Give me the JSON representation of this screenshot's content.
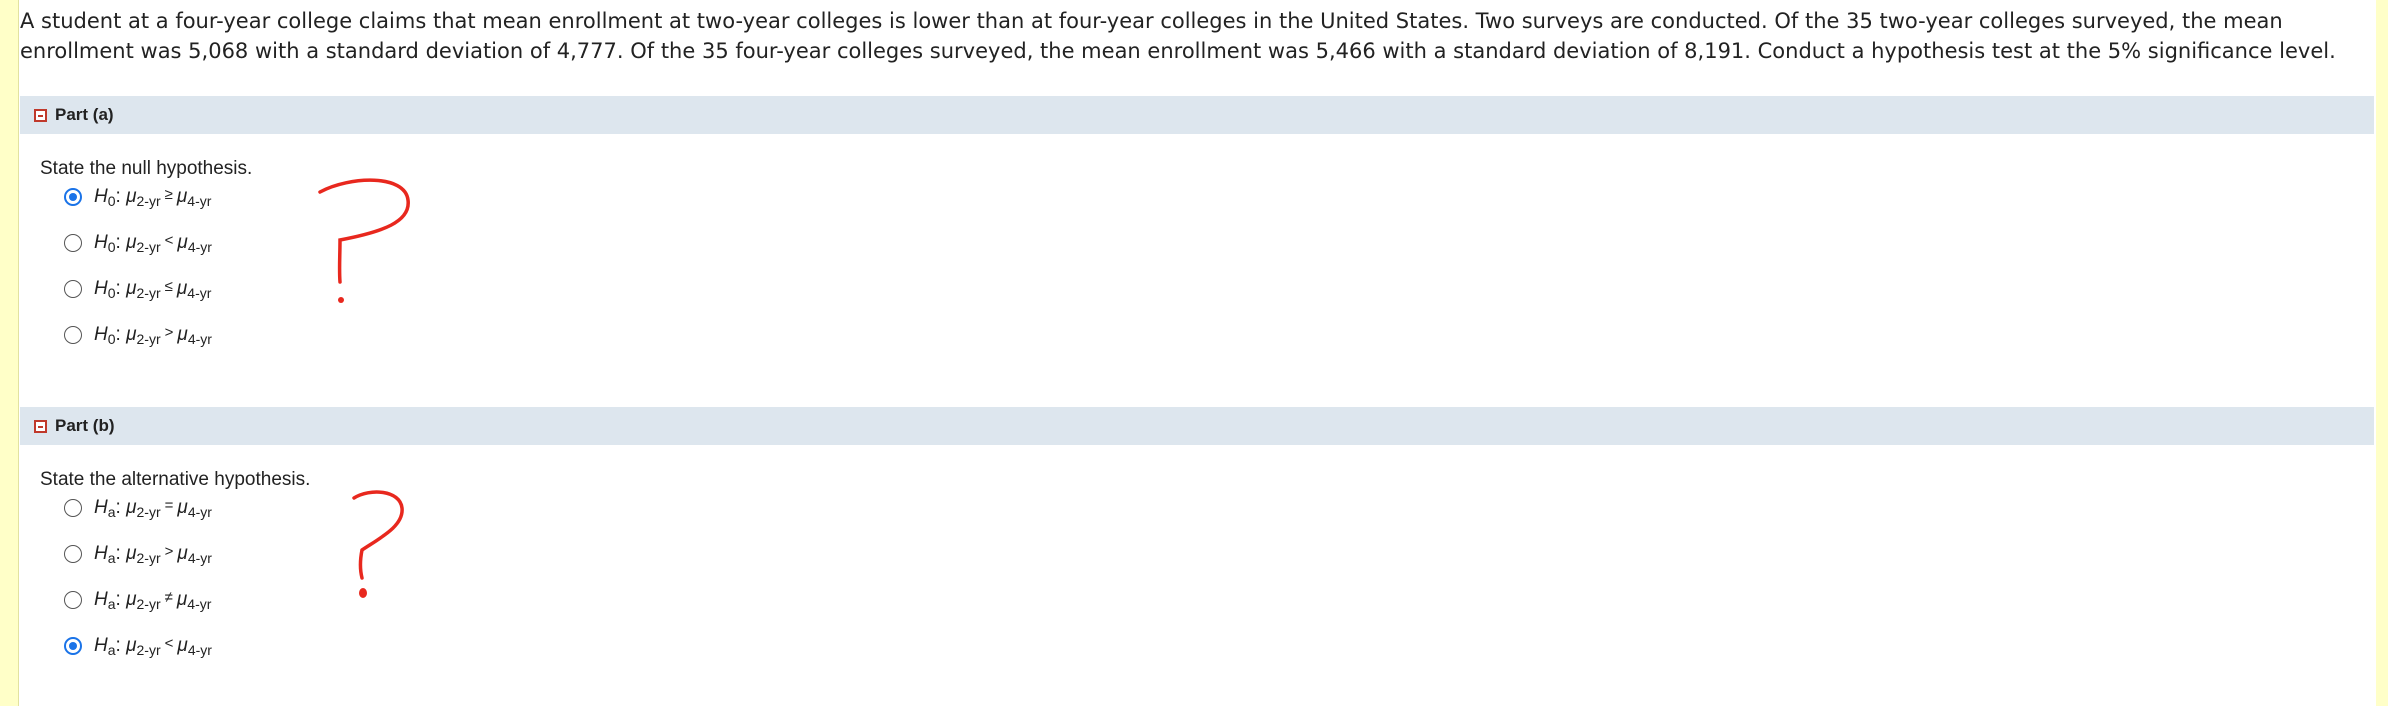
{
  "question": {
    "text": "A student at a four-year college claims that mean enrollment at two-year colleges is lower than at four-year colleges in the United States. Two surveys are conducted. Of the 35 two-year colleges surveyed, the mean enrollment was 5,068 with a standard deviation of 4,777. Of the 35 four-year colleges surveyed, the mean enrollment was 5,466 with a standard deviation of 8,191. Conduct a hypothesis test at the 5% significance level."
  },
  "part_a": {
    "title": "Part (a)",
    "prompt": "State the null hypothesis.",
    "hyp_letter": "H",
    "hyp_sub": "0",
    "mu": "μ",
    "left_sub": "2-yr",
    "right_sub": "4-yr",
    "options": [
      {
        "relation": "≥",
        "checked": true
      },
      {
        "relation": "<",
        "checked": false
      },
      {
        "relation": "≤",
        "checked": false
      },
      {
        "relation": ">",
        "checked": false
      }
    ]
  },
  "part_b": {
    "title": "Part (b)",
    "prompt": "State the alternative hypothesis.",
    "hyp_letter": "H",
    "hyp_sub": "a",
    "mu": "μ",
    "left_sub": "2-yr",
    "right_sub": "4-yr",
    "options": [
      {
        "relation": "=",
        "checked": false
      },
      {
        "relation": ">",
        "checked": false
      },
      {
        "relation": "≠",
        "checked": false
      },
      {
        "relation": "<",
        "checked": true
      }
    ]
  },
  "colors": {
    "accent": "#1a73e8",
    "header_bg": "#dde6ee",
    "annotation": "#e8281e"
  }
}
